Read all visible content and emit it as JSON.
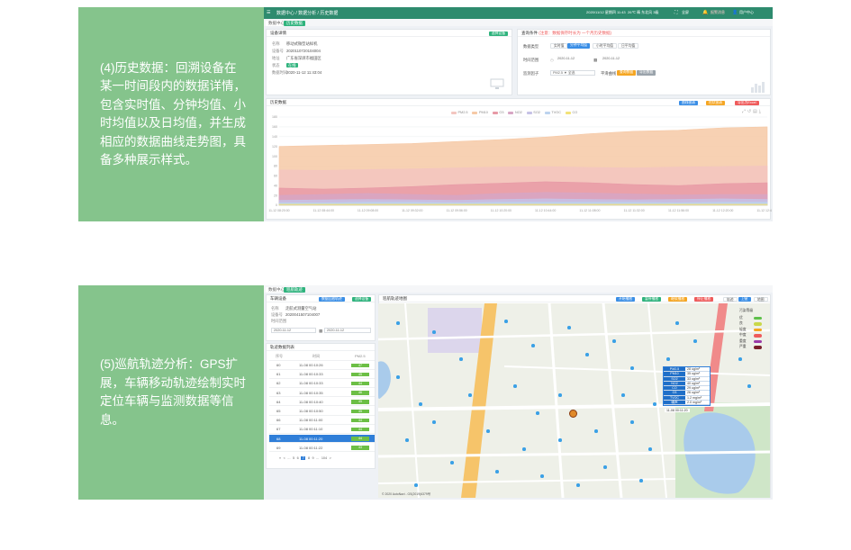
{
  "section1": {
    "caption": "(4)历史数据：回溯设备在某一时间段内的数据详情，包含实时值、分钟均值、小时均值以及日均值，并生成相应的数据曲线走势图，具备多种展示样式。",
    "topbar": {
      "breadcrumb": "数据中心 / 数据分析 / 历史数据",
      "date_block": "2020/11/12 星期四 11:43",
      "weather": "26℃ 晴 东北风 3级",
      "fullscreen": "全屏",
      "alarm": "报警消息",
      "user": "用户中心"
    },
    "tabs": [
      "数据中心",
      "历史数据"
    ],
    "device_card": {
      "title": "设备详情",
      "button": "选择设备",
      "fields": [
        {
          "k": "名称",
          "v": "移动式微型站样机"
        },
        {
          "k": "设备号",
          "v": "2020110720104004"
        },
        {
          "k": "地址",
          "v": "广东省深圳市福田区"
        },
        {
          "k": "状态",
          "v": "在线"
        },
        {
          "k": "数据时间",
          "v": "2020-11-12 11:43:04"
        }
      ]
    },
    "query_card": {
      "title": "查询条件",
      "note": "(注意：数据保存时长为 一个月历史数据)",
      "labels": {
        "type": "数据类型",
        "time": "时间范围",
        "factor": "监测因子"
      },
      "type_options": [
        "实时值",
        "分钟平均值",
        "小时平均值",
        "日平均值"
      ],
      "date_start": "2020-11-12",
      "date_end": "2020-11-12",
      "factor_placeholder": "PM2.5 ▼ 全选",
      "mode_label": "平滑曲线",
      "query_btn": "查询数据",
      "export_btn": "导出数据"
    },
    "chart_card": {
      "title": "历史数据",
      "buttons": [
        "曲线图表",
        "柱状图表",
        "导出为Excel"
      ],
      "legend": [
        "PM2.5",
        "PM10",
        "O3",
        "NO2",
        "SO2",
        "TVOC",
        "CO"
      ]
    }
  },
  "chart_data": {
    "type": "area",
    "title": "",
    "xlabel": "",
    "ylabel": "",
    "ylim": [
      0,
      180
    ],
    "yticks": [
      0,
      20,
      40,
      60,
      80,
      100,
      120,
      140,
      160,
      180
    ],
    "categories": [
      "11-12 08:20:00",
      "11-12 08:44:00",
      "11-12 09:08:00",
      "11-12 09:32:00",
      "11-12 09:56:00",
      "11-12 10:20:00",
      "11-12 10:44:00",
      "11-12 11:08:00",
      "11-12 11:32:00",
      "11-12 11:56:00",
      "11-12 12:20:00",
      "11-12 12:44:00"
    ],
    "series": [
      {
        "name": "PM10",
        "color": "#f6c9a6",
        "values": [
          120,
          122,
          124,
          126,
          130,
          134,
          139,
          146,
          151,
          153,
          158,
          160
        ]
      },
      {
        "name": "PM2.5",
        "color": "#f3c6c0",
        "values": [
          72,
          71,
          73,
          74,
          76,
          78,
          79,
          77,
          76,
          78,
          79,
          80
        ]
      },
      {
        "name": "O3",
        "color": "#e79aa6",
        "values": [
          35,
          33,
          35,
          38,
          42,
          45,
          48,
          46,
          42,
          40,
          44,
          46
        ]
      },
      {
        "name": "NO2",
        "color": "#d7a6c4",
        "values": [
          20,
          22,
          24,
          22,
          20,
          24,
          26,
          25,
          23,
          21,
          22,
          22
        ]
      },
      {
        "name": "SO2",
        "color": "#c6c2e6",
        "values": [
          10,
          11,
          12,
          11,
          10,
          12,
          13,
          12,
          11,
          12,
          13,
          12
        ]
      },
      {
        "name": "TVOC",
        "color": "#bcd3ee",
        "values": [
          5,
          5,
          6,
          6,
          5,
          6,
          6,
          6,
          6,
          5,
          6,
          6
        ]
      },
      {
        "name": "CO",
        "color": "#f2e27a",
        "values": [
          2,
          2,
          2,
          2,
          2,
          2,
          2,
          2,
          2,
          2,
          2,
          2
        ]
      }
    ],
    "grid": true,
    "legend": "top-center"
  },
  "section2": {
    "caption": "(5)巡航轨迹分析：GPS扩展，车辆移动轨迹绘制实时定位车辆与监测数据等信息。",
    "tabs": [
      "数据中心",
      "巡航轨迹"
    ],
    "device_card": {
      "title": "车辆设备",
      "buttons": [
        "数据回放轨迹",
        "选择设备"
      ],
      "fields": [
        {
          "k": "名称",
          "v": "走航式测量空气站"
        },
        {
          "k": "设备号",
          "v": "2020041507104007"
        },
        {
          "k": "时间范围",
          "v": ""
        }
      ],
      "date_start": "2020-11-12",
      "date_end": "2020-11-12"
    },
    "table": {
      "title": "轨迹数据列表",
      "headers": [
        "序号",
        "时间",
        "PM2.5"
      ],
      "rows": [
        {
          "no": "60",
          "time": "11-08 00:10:26",
          "val": "47"
        },
        {
          "no": "61",
          "time": "11-08 00:10:33",
          "val": "45"
        },
        {
          "no": "62",
          "time": "11-08 00:10:33",
          "val": "44"
        },
        {
          "no": "63",
          "time": "11-08 00:10:35",
          "val": "46"
        },
        {
          "no": "64",
          "time": "11-08 00:10:40",
          "val": "45"
        },
        {
          "no": "65",
          "time": "11-08 00:10:50",
          "val": "45"
        },
        {
          "no": "66",
          "time": "11-08 00:11:00",
          "val": "44"
        },
        {
          "no": "67",
          "time": "11-08 00:11:10",
          "val": "44"
        },
        {
          "no": "68",
          "time": "11-08 00:11:20",
          "val": "44"
        },
        {
          "no": "69",
          "time": "11-08 00:11:22",
          "val": "43"
        }
      ],
      "selected_index": 8,
      "pager": [
        "«",
        "<",
        "...",
        "5",
        "6",
        "7",
        "8",
        "9",
        "...",
        "104",
        ">"
      ]
    },
    "map_card": {
      "title": "巡航轨迹地图",
      "buttons": [
        "开始播放",
        "暂停播放",
        "继续播放",
        "停止播放"
      ],
      "toggles": [
        "轨迹",
        "卫星",
        "地图"
      ],
      "legend_title": "污染等级",
      "legend": [
        {
          "label": "优",
          "color": "#5ec04a"
        },
        {
          "label": "良",
          "color": "#c9d84a"
        },
        {
          "label": "轻度",
          "color": "#f5a623"
        },
        {
          "label": "中度",
          "color": "#ef5b5b"
        },
        {
          "label": "重度",
          "color": "#9b3aa8"
        },
        {
          "label": "严重",
          "color": "#7a1f2b"
        }
      ],
      "popup": [
        {
          "k": "PM2.5",
          "v": "28 ug/m³"
        },
        {
          "k": "PM10",
          "v": "35 ug/m³"
        },
        {
          "k": "SO2",
          "v": "33 ug/m³"
        },
        {
          "k": "NO2",
          "v": "40 ug/m³"
        },
        {
          "k": "CO",
          "v": "29 ug/m³"
        },
        {
          "k": "O3",
          "v": "26 ug/m³"
        },
        {
          "k": "TVOC",
          "v": "1.2 mg/m³"
        },
        {
          "k": "噪声",
          "v": "2.0 mg/m³"
        }
      ],
      "popup_time": "11-08 00:11:20",
      "copyright": "© 2020 AutoNavi - GS(2019)6379号"
    }
  }
}
